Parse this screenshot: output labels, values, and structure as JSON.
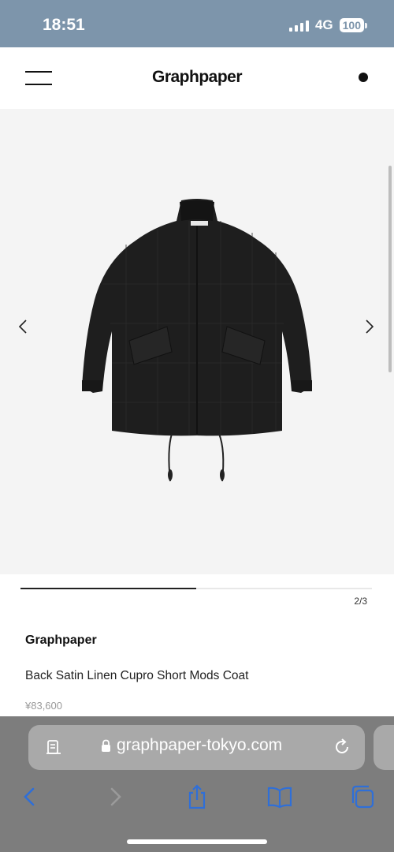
{
  "status_bar": {
    "time": "18:51",
    "network": "4G",
    "battery": "100"
  },
  "header": {
    "logo": "Graphpaper"
  },
  "gallery": {
    "counter": "2/3",
    "current_index": 2,
    "total": 3,
    "progress_fraction": 0.5
  },
  "product": {
    "brand": "Graphpaper",
    "name": "Back Satin Linen Cupro Short Mods Coat",
    "price": "¥83,600"
  },
  "browser": {
    "url": "graphpaper-tokyo.com"
  },
  "colors": {
    "status_bar": "#7d95ab",
    "browser_bar": "#7d7d7d",
    "url_field": "#a9a9a9",
    "toolbar_icon": "#2f6fd8",
    "gallery_bg": "#f4f4f4",
    "price_text": "#9a9a9a"
  },
  "icons": {
    "menu": "hamburger-icon",
    "cart": "cart-dot-icon",
    "prev": "chevron-left-icon",
    "next": "chevron-right-icon",
    "reader": "reader-mode-icon",
    "lock": "lock-icon",
    "reload": "reload-icon",
    "back": "back-icon",
    "forward": "forward-icon",
    "share": "share-icon",
    "bookmarks": "bookmarks-icon",
    "tabs": "tabs-icon"
  }
}
